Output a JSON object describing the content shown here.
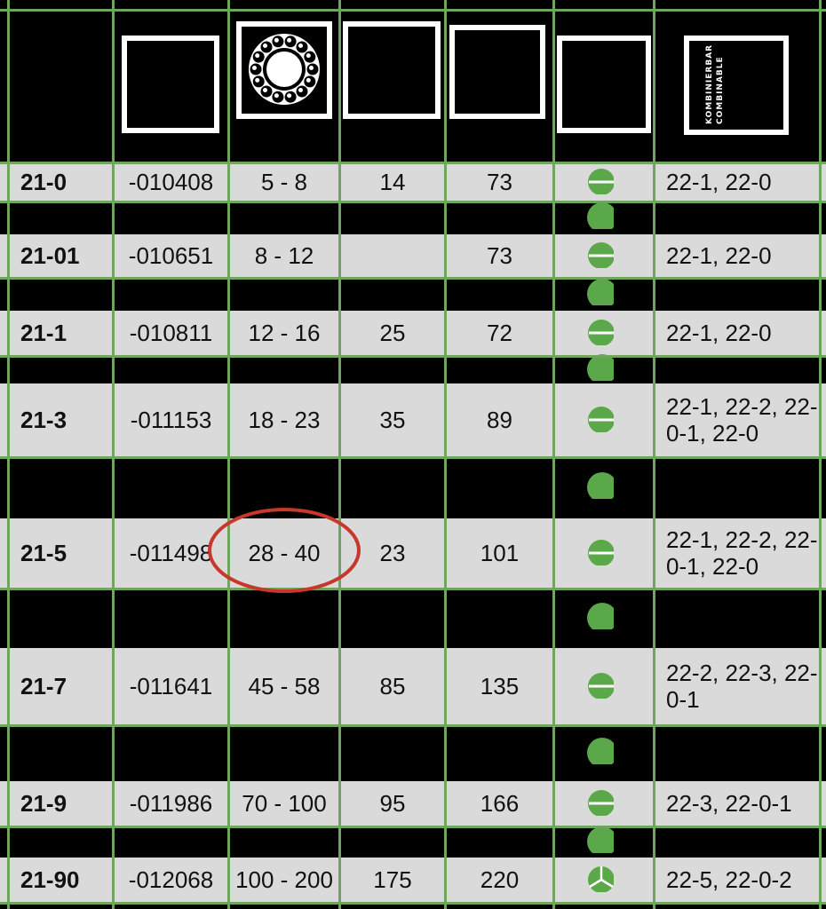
{
  "table": {
    "header_combinable_lines": [
      "KOMBINIERBAR",
      "COMBINABLE"
    ],
    "rows": [
      {
        "model": "21-0",
        "code": "-010408",
        "range": "5 - 8",
        "c4": "14",
        "c5": "73",
        "combinable": "22-1, 22-0",
        "badge": "stripe"
      },
      {
        "model": "21-01",
        "code": "-010651",
        "range": "8 - 12",
        "c4": "",
        "c5": "73",
        "combinable": "22-1, 22-0",
        "badge": "stripe"
      },
      {
        "model": "21-1",
        "code": "-010811",
        "range": "12 - 16",
        "c4": "25",
        "c5": "72",
        "combinable": "22-1, 22-0",
        "badge": "stripe"
      },
      {
        "model": "21-3",
        "code": "-011153",
        "range": "18 - 23",
        "c4": "35",
        "c5": "89",
        "combinable": "22-1, 22-2, 22-0-1, 22-0",
        "badge": "stripe"
      },
      {
        "model": "21-5",
        "code": "-011498",
        "range": "28 - 40",
        "c4": "23",
        "c5": "101",
        "combinable": "22-1, 22-2, 22-0-1, 22-0",
        "badge": "stripe"
      },
      {
        "model": "21-7",
        "code": "-011641",
        "range": "45 - 58",
        "c4": "85",
        "c5": "135",
        "combinable": "22-2, 22-3, 22-0-1",
        "badge": "stripe"
      },
      {
        "model": "21-9",
        "code": "-011986",
        "range": "70 - 100",
        "c4": "95",
        "c5": "166",
        "combinable": "22-3, 22-0-1",
        "badge": "stripe"
      },
      {
        "model": "21-90",
        "code": "-012068",
        "range": "100 - 200",
        "c4": "175",
        "c5": "220",
        "combinable": "22-5, 22-0-2",
        "badge": "tri"
      }
    ],
    "highlight": {
      "target": "21-5 range",
      "color": "#c8372b"
    }
  },
  "colors": {
    "grid": "#6fa55f",
    "light_row": "#dadada",
    "badge": "#5aa84a",
    "circle": "#c8372b"
  }
}
